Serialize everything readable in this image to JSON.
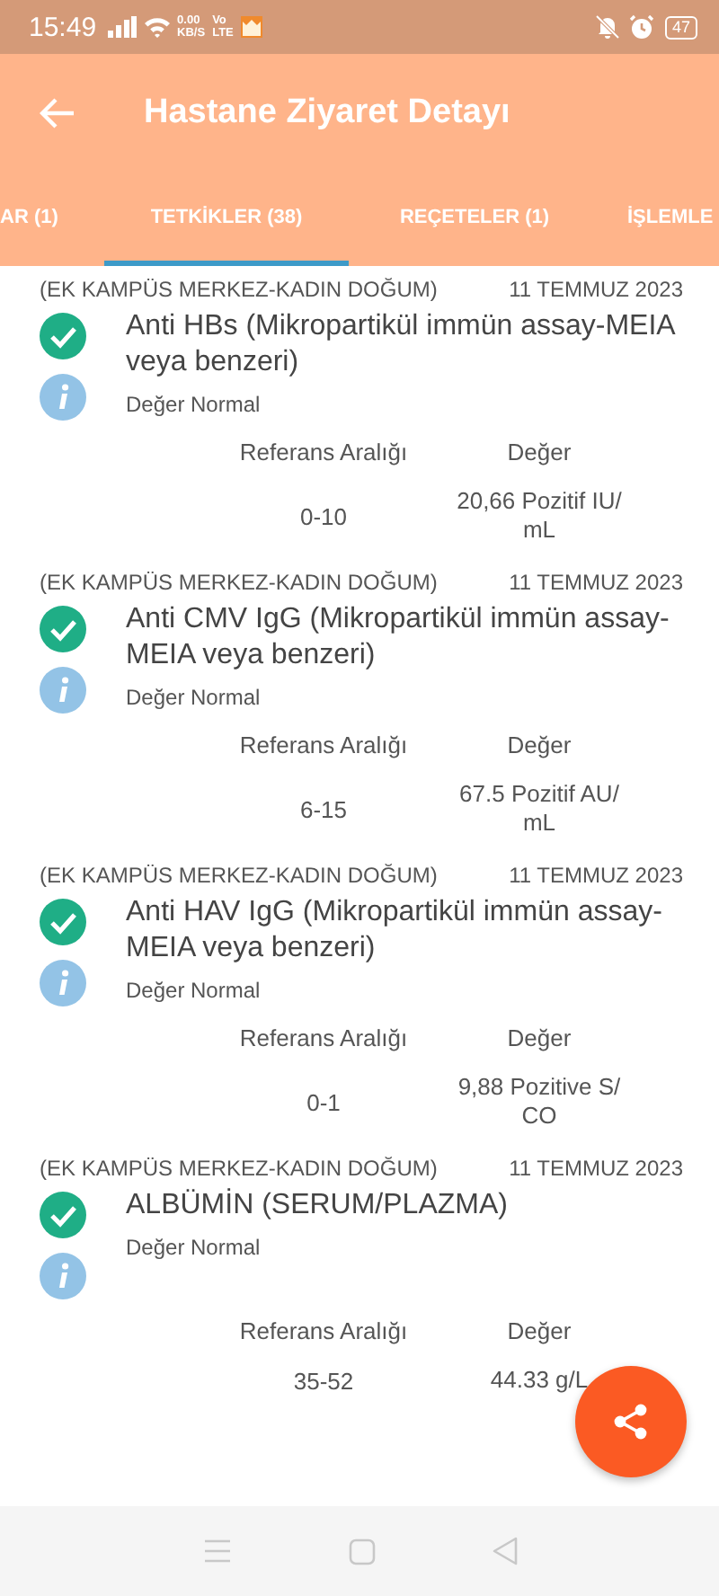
{
  "status_bar": {
    "time": "15:49",
    "net_speed": "0.00",
    "net_unit": "KB/S",
    "volte": "Vo",
    "lte": "LTE",
    "battery": "47"
  },
  "header": {
    "title": "Hastane Ziyaret Detayı"
  },
  "tabs": [
    {
      "label": "AR (1)",
      "selected": false
    },
    {
      "label": "TETKİKLER (38)",
      "selected": true
    },
    {
      "label": "REÇETELER (1)",
      "selected": false
    },
    {
      "label": "İŞLEMLE",
      "selected": false
    }
  ],
  "results": [
    {
      "site": "(EK KAMPÜS MERKEZ-KADIN DOĞUM)",
      "date": "11 TEMMUZ 2023",
      "normal": true,
      "name": "Anti HBs  (Mikropartikül immün assay-MEIA veya benzeri)",
      "note": "Değer Normal",
      "range_label": "Referans Aralığı",
      "value_label": "Değer",
      "range": "0-10",
      "value": "20,66 Pozitif IU/mL"
    },
    {
      "site": "(EK KAMPÜS MERKEZ-KADIN DOĞUM)",
      "date": "11 TEMMUZ 2023",
      "normal": true,
      "name": "Anti CMV IgG (Mikropartikül immün assay-MEIA veya benzeri)",
      "note": "Değer Normal",
      "range_label": "Referans Aralığı",
      "value_label": "Değer",
      "range": "6-15",
      "value": "67.5 Pozitif AU/mL"
    },
    {
      "site": "(EK KAMPÜS MERKEZ-KADIN DOĞUM)",
      "date": "11 TEMMUZ 2023",
      "normal": true,
      "name": "Anti HAV IgG (Mikropartikül immün assay-MEIA veya benzeri)",
      "note": "Değer Normal",
      "range_label": "Referans Aralığı",
      "value_label": "Değer",
      "range": "0-1",
      "value": "9,88 Pozitive S/CO"
    },
    {
      "site": "(EK KAMPÜS MERKEZ-KADIN DOĞUM)",
      "date": "11 TEMMUZ 2023",
      "normal": true,
      "name": "ALBÜMİN (SERUM/PLAZMA)",
      "note": "Değer Normal",
      "range_label": "Referans Aralığı",
      "value_label": "Değer",
      "range": "35-52",
      "value": "44.33 g/L"
    }
  ]
}
